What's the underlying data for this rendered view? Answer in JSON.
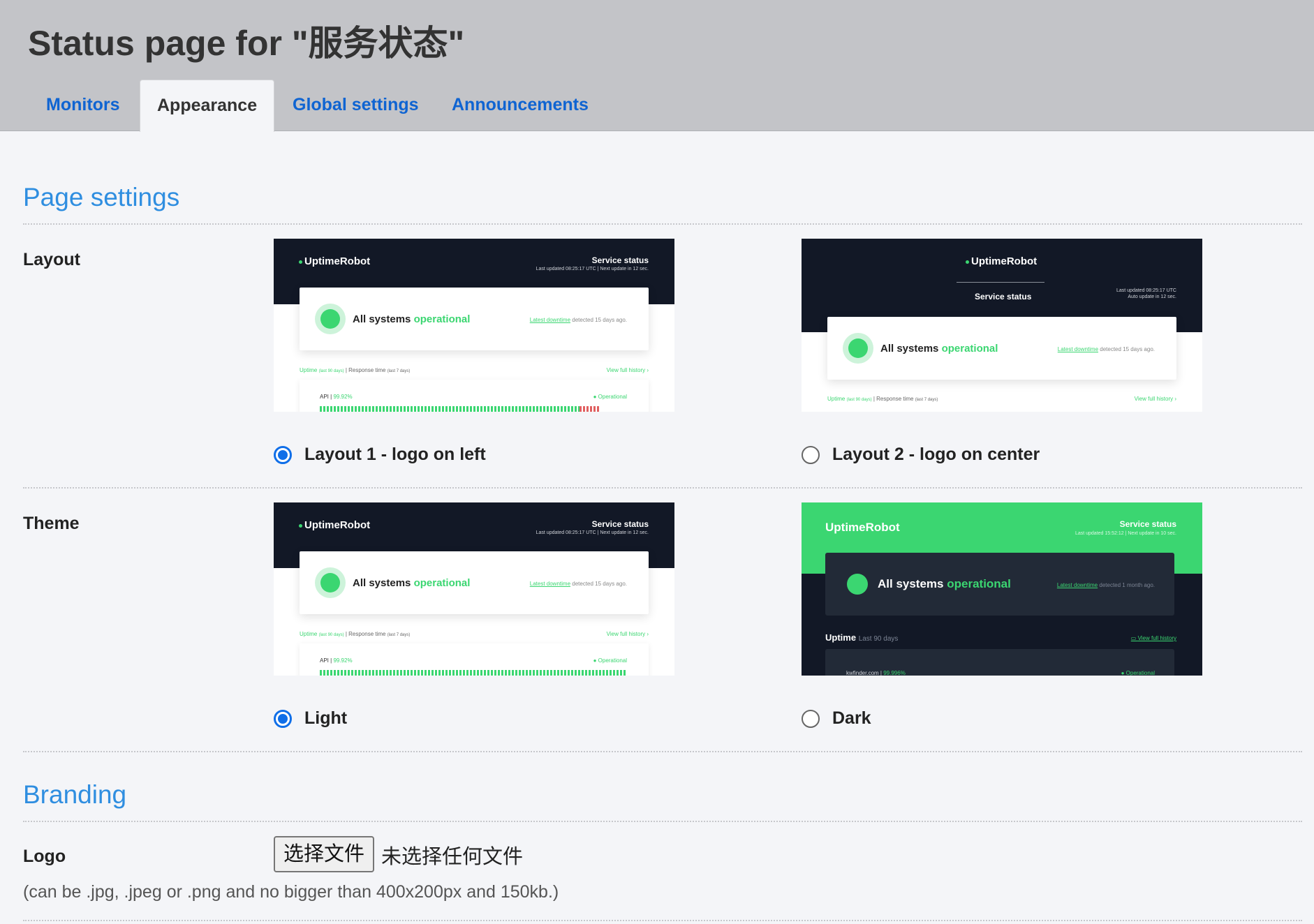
{
  "header": {
    "title": "Status page for \"服务状态\"",
    "tabs": [
      {
        "label": "Monitors",
        "active": false
      },
      {
        "label": "Appearance",
        "active": true
      },
      {
        "label": "Global settings",
        "active": false
      },
      {
        "label": "Announcements",
        "active": false
      }
    ]
  },
  "page_settings": {
    "title": "Page settings",
    "layout": {
      "label": "Layout",
      "options": [
        {
          "label": "Layout 1 - logo on left",
          "selected": true
        },
        {
          "label": "Layout 2 - logo on center",
          "selected": false
        }
      ]
    },
    "theme": {
      "label": "Theme",
      "options": [
        {
          "label": "Light",
          "selected": true
        },
        {
          "label": "Dark",
          "selected": false
        }
      ]
    }
  },
  "previews": {
    "logo": "UptimeRobot",
    "service_status": "Service status",
    "last_updated": "Last updated 08:25:17 UTC | Next update in 12 sec.",
    "last_updated_center": "Last updated 08:25:17 UTC",
    "auto_update": "Auto update in 12 sec.",
    "all_systems": "All systems",
    "operational": "operational",
    "latest_downtime": "Latest downtime",
    "detected": "detected 15 days ago.",
    "uptime": "Uptime",
    "last_90": "(last 90 days)",
    "response_time": "Response time",
    "last_7": "(last 7 days)",
    "view_full_history": "View full history",
    "api_name": "API",
    "api_uptime": "99.92%",
    "api_status": "Operational",
    "dark_last_updated": "Last updated 15:52:12 | Next update in 10 sec.",
    "dark_detected": "detected 1 month ago.",
    "dark_uptime": "Uptime",
    "dark_last_90": "Last 90 days",
    "dark_monitor": "kwfinder.com",
    "dark_monitor_uptime": "99.996%",
    "dark_monitor_status": "Operational"
  },
  "branding": {
    "title": "Branding",
    "logo": {
      "label": "Logo",
      "button_label": "选择文件",
      "no_file_text": "未选择任何文件",
      "hint": "(can be .jpg, .jpeg or .png and no bigger than 400x200px and 150kb.)"
    }
  },
  "colors": {
    "header_bg": "#c3c4c8",
    "tab_link": "#0f64d2",
    "section_title": "#2f8ee0",
    "radio_accent": "#0f6ee8",
    "preview_dark": "#121826",
    "preview_green": "#3bd671"
  }
}
